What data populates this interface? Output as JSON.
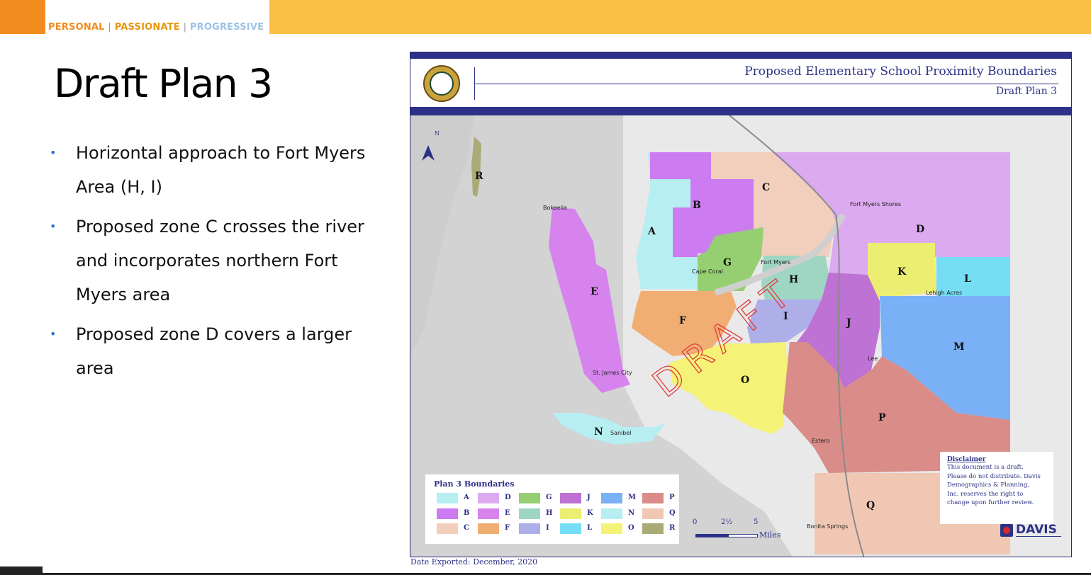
{
  "header": {
    "tagline": [
      "PERSONAL",
      "PASSIONATE",
      "PROGRESSIVE"
    ],
    "separator": "|",
    "colors": {
      "orange": "#f28c1e",
      "gold": "#fbbf45",
      "light_blue": "#9cc3e4"
    }
  },
  "slide": {
    "title": "Draft Plan 3",
    "bullets": [
      "Horizontal approach to Fort Myers Area (H, I)",
      "Proposed zone C crosses the river and incorporates northern Fort Myers area",
      "Proposed zone D covers a larger area"
    ],
    "bullet_symbol": "•"
  },
  "map": {
    "title": "Proposed Elementary School Proximity Boundaries",
    "subtitle": "Draft Plan 3",
    "north_label": "N",
    "watermark": "DRAFT",
    "zones": [
      {
        "label": "A",
        "color": "#b6eef2"
      },
      {
        "label": "B",
        "color": "#cc7cf0"
      },
      {
        "label": "C",
        "color": "#f1cfbc"
      },
      {
        "label": "D",
        "color": "#dcaaf0"
      },
      {
        "label": "E",
        "color": "#d683ee"
      },
      {
        "label": "F",
        "color": "#f0ae72"
      },
      {
        "label": "G",
        "color": "#95cf72"
      },
      {
        "label": "H",
        "color": "#9ed5c3"
      },
      {
        "label": "I",
        "color": "#aeaee8"
      },
      {
        "label": "J",
        "color": "#bd72d4"
      },
      {
        "label": "K",
        "color": "#ecee72"
      },
      {
        "label": "L",
        "color": "#76def4"
      },
      {
        "label": "M",
        "color": "#7ab0f5"
      },
      {
        "label": "N",
        "color": "#b6eef2"
      },
      {
        "label": "O",
        "color": "#f4f277"
      },
      {
        "label": "P",
        "color": "#d98c88"
      },
      {
        "label": "Q",
        "color": "#f0c7b3"
      },
      {
        "label": "R",
        "color": "#aaaa76"
      }
    ],
    "places": [
      "Bokeelia",
      "Fort Myers Shores",
      "Cape Coral",
      "Fort Myers",
      "Lehigh Acres",
      "Lee",
      "St. James City",
      "Sanibel",
      "Estero",
      "Bonita Springs"
    ],
    "legend": {
      "title": "Plan 3 Boundaries"
    },
    "scale": {
      "ticks": [
        "0",
        "2½",
        "5"
      ],
      "unit": "Miles"
    },
    "disclaimer": {
      "title": "Disclaimer",
      "lines": [
        "This document is a draft.",
        "Please do not distribute. Davis",
        "Demographics & Planning,",
        "Inc. reserves the right to",
        "change upon further review."
      ]
    },
    "logo_text": "DAVIS",
    "date_exported": "Date Exported: December, 2020"
  }
}
